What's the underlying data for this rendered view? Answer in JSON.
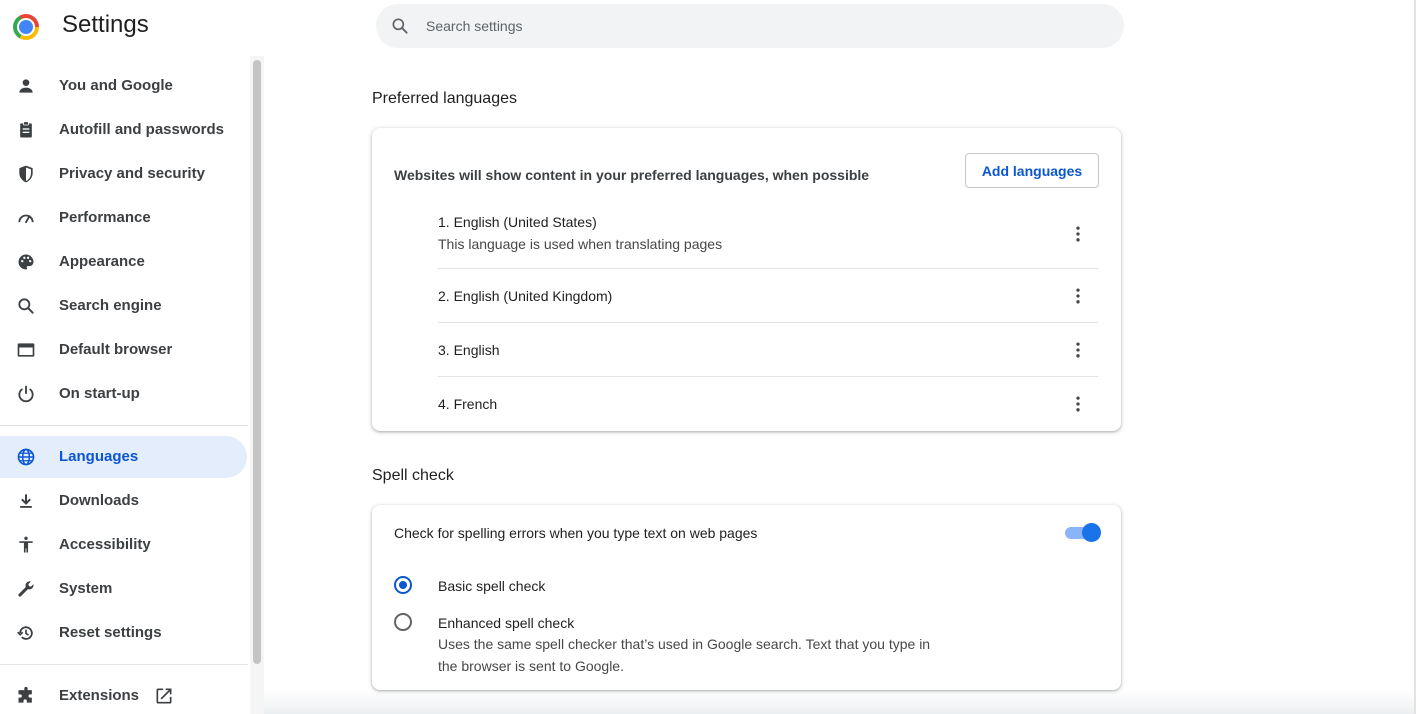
{
  "header": {
    "title": "Settings",
    "search_placeholder": "Search settings"
  },
  "sidebar": {
    "items": [
      {
        "label": "You and Google",
        "icon": "person-icon"
      },
      {
        "label": "Autofill and passwords",
        "icon": "clipboard-icon"
      },
      {
        "label": "Privacy and security",
        "icon": "shield-icon"
      },
      {
        "label": "Performance",
        "icon": "speedometer-icon"
      },
      {
        "label": "Appearance",
        "icon": "palette-icon"
      },
      {
        "label": "Search engine",
        "icon": "search-icon"
      },
      {
        "label": "Default browser",
        "icon": "browser-window-icon"
      },
      {
        "label": "On start-up",
        "icon": "power-icon"
      },
      {
        "label": "Languages",
        "icon": "globe-icon",
        "active": true
      },
      {
        "label": "Downloads",
        "icon": "download-icon"
      },
      {
        "label": "Accessibility",
        "icon": "accessibility-icon"
      },
      {
        "label": "System",
        "icon": "wrench-icon"
      },
      {
        "label": "Reset settings",
        "icon": "history-icon"
      },
      {
        "label": "Extensions",
        "icon": "puzzle-icon"
      }
    ]
  },
  "preferred_languages": {
    "title": "Preferred languages",
    "description": "Websites will show content in your preferred languages, when possible",
    "add_button": "Add languages",
    "languages": [
      {
        "name": "1. English (United States)",
        "sub": "This language is used when translating pages"
      },
      {
        "name": "2. English (United Kingdom)"
      },
      {
        "name": "3. English"
      },
      {
        "name": "4. French"
      }
    ]
  },
  "spell_check": {
    "title": "Spell check",
    "toggle_label": "Check for spelling errors when you type text on web pages",
    "toggle_on": true,
    "options": [
      {
        "label": "Basic spell check",
        "selected": true
      },
      {
        "label": "Enhanced spell check",
        "selected": false,
        "sub": "Uses the same spell checker that’s used in Google search. Text that you type in the browser is sent to Google."
      }
    ]
  },
  "colors": {
    "accent": "#0b57d0",
    "active_nav_bg": "#e3edfb",
    "toggle_knob": "#1a73e8"
  }
}
